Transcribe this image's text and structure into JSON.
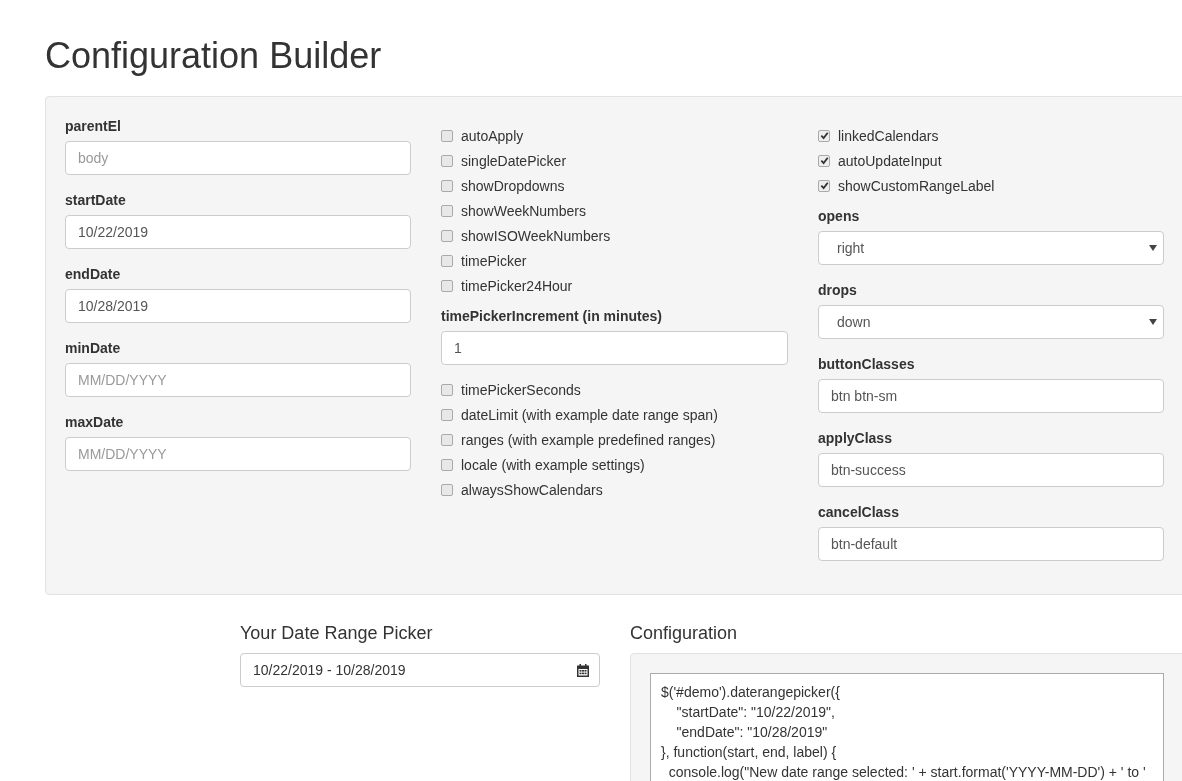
{
  "title": "Configuration Builder",
  "builder": {
    "columns": [
      {
        "items": [
          {
            "kind": "text",
            "label": "parentEl",
            "placeholder": "body"
          },
          {
            "kind": "text",
            "label": "startDate",
            "value": "10/22/2019"
          },
          {
            "kind": "text",
            "label": "endDate",
            "value": "10/28/2019"
          },
          {
            "kind": "text",
            "label": "minDate",
            "placeholder": "MM/DD/YYYY"
          },
          {
            "kind": "text",
            "label": "maxDate",
            "placeholder": "MM/DD/YYYY"
          }
        ]
      },
      {
        "items": [
          {
            "kind": "checkbox",
            "label": "autoApply",
            "checked": false
          },
          {
            "kind": "checkbox",
            "label": "singleDatePicker",
            "checked": false
          },
          {
            "kind": "checkbox",
            "label": "showDropdowns",
            "checked": false
          },
          {
            "kind": "checkbox",
            "label": "showWeekNumbers",
            "checked": false
          },
          {
            "kind": "checkbox",
            "label": "showISOWeekNumbers",
            "checked": false
          },
          {
            "kind": "checkbox",
            "label": "timePicker",
            "checked": false
          },
          {
            "kind": "checkbox",
            "label": "timePicker24Hour",
            "checked": false
          },
          {
            "kind": "text",
            "label": "timePickerIncrement (in minutes)",
            "value": "1"
          },
          {
            "kind": "checkbox",
            "label": "timePickerSeconds",
            "checked": false
          },
          {
            "kind": "checkbox",
            "label": "dateLimit (with example date range span)",
            "checked": false
          },
          {
            "kind": "checkbox",
            "label": "ranges (with example predefined ranges)",
            "checked": false
          },
          {
            "kind": "checkbox",
            "label": "locale (with example settings)",
            "checked": false
          },
          {
            "kind": "checkbox",
            "label": "alwaysShowCalendars",
            "checked": false
          }
        ]
      },
      {
        "items": [
          {
            "kind": "checkbox",
            "label": "linkedCalendars",
            "checked": true
          },
          {
            "kind": "checkbox",
            "label": "autoUpdateInput",
            "checked": true
          },
          {
            "kind": "checkbox",
            "label": "showCustomRangeLabel",
            "checked": true
          },
          {
            "kind": "select",
            "label": "opens",
            "value": "right"
          },
          {
            "kind": "select",
            "label": "drops",
            "value": "down"
          },
          {
            "kind": "text",
            "label": "buttonClasses",
            "value": "btn btn-sm"
          },
          {
            "kind": "text",
            "label": "applyClass",
            "value": "btn-success"
          },
          {
            "kind": "text",
            "label": "cancelClass",
            "value": "btn-default"
          }
        ]
      }
    ]
  },
  "picker": {
    "heading": "Your Date Range Picker",
    "value": "10/22/2019 - 10/28/2019"
  },
  "configuration": {
    "heading": "Configuration",
    "code_lines": [
      "$('#demo').daterangepicker({",
      "    \"startDate\": \"10/22/2019\",",
      "    \"endDate\": \"10/28/2019\"",
      "}, function(start, end, label) {",
      "  console.log(\"New date range selected: ' + start.format('YYYY-MM-DD') + ' to '"
    ]
  }
}
